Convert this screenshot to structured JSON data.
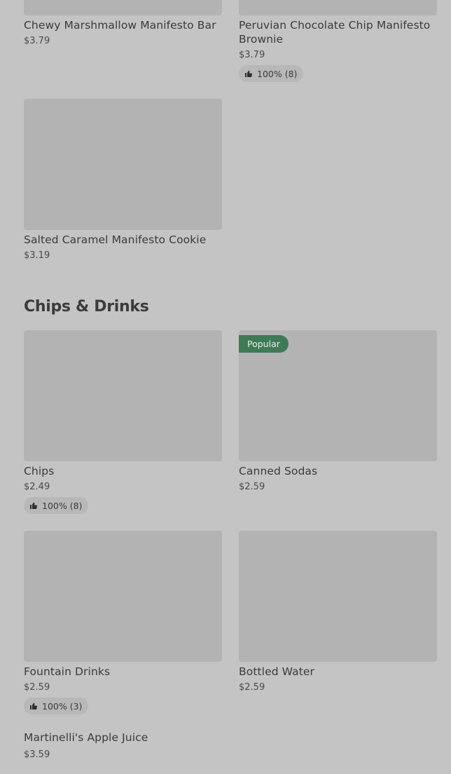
{
  "sections": {
    "desserts": {
      "items": [
        {
          "name": "Chewy Marshmallow Manifesto Bar",
          "price": "$3.79"
        },
        {
          "name": "Peruvian Chocolate Chip Manifesto Brownie",
          "price": "$3.79",
          "rating": "100% (8)"
        },
        {
          "name": "Salted Caramel Manifesto Cookie",
          "price": "$3.19"
        }
      ]
    },
    "chips_drinks": {
      "title": "Chips & Drinks",
      "items": [
        {
          "name": "Chips",
          "price": "$2.49",
          "rating": "100% (8)"
        },
        {
          "name": "Canned Sodas",
          "price": "$2.59",
          "badge": "Popular"
        },
        {
          "name": "Fountain Drinks",
          "price": "$2.59",
          "rating": "100% (3)"
        },
        {
          "name": "Bottled Water",
          "price": "$2.59"
        },
        {
          "name": "Martinelli's Apple Juice",
          "price": "$3.59"
        }
      ]
    }
  },
  "icons": {
    "rating": "thumbs-up-icon"
  },
  "colors": {
    "background": "#c4c4c4",
    "image_placeholder": "#b3b3b3",
    "popular_badge": "#3f7a57"
  }
}
